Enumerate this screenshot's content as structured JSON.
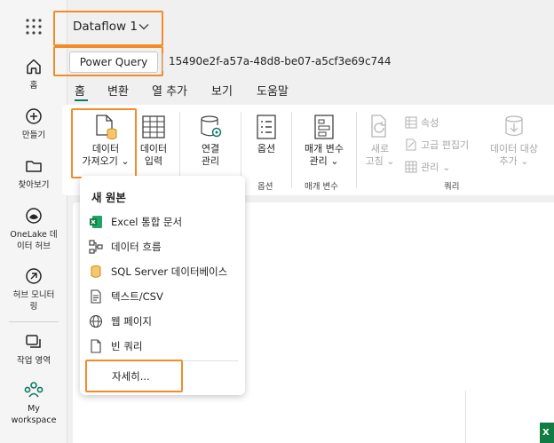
{
  "header": {
    "title": "Dataflow 1"
  },
  "query_bar": {
    "power_query_label": "Power Query",
    "query_id": "15490e2f-a57a-48d8-be07-a5cf3e69c744"
  },
  "rail": {
    "items": [
      {
        "label": "홈",
        "icon": "home-icon"
      },
      {
        "label": "만들기",
        "icon": "plus-circle-icon"
      },
      {
        "label": "찾아보기",
        "icon": "folder-icon"
      },
      {
        "label": "OneLake 데이터 허브",
        "line1": "OneLake 데",
        "line2": "이터 허브",
        "icon": "onelake-icon"
      },
      {
        "label": "허브 모니터링",
        "line1": "허브 모니터",
        "line2": "링",
        "icon": "monitor-icon"
      },
      {
        "label": "작업 영역",
        "icon": "workspaces-icon"
      },
      {
        "label": "My workspace",
        "line1": "My",
        "line2": "workspace",
        "icon": "my-workspace-icon"
      }
    ]
  },
  "tabs": [
    "홈",
    "변환",
    "열 추가",
    "보기",
    "도움말"
  ],
  "ribbon": {
    "get_data": {
      "line1": "데이터",
      "line2": "가져오기"
    },
    "enter_data": {
      "line1": "데이터",
      "line2": "입력"
    },
    "manage_connections": {
      "line1": "연결",
      "line2": "관리"
    },
    "options": {
      "line1": "옵션"
    },
    "manage_parameters": {
      "line1": "매개 변수",
      "line2": "관리"
    },
    "refresh": {
      "line1": "새로",
      "line2": "고침"
    },
    "properties": "속성",
    "advanced_editor": "고급 편집기",
    "manage": "관리",
    "data_destination": {
      "line1": "데이터 대상",
      "line2": "추가"
    },
    "groups": {
      "options": "옵션",
      "parameters": "매개 변수",
      "query": "쿼리"
    }
  },
  "dropdown": {
    "title": "새 원본",
    "items": [
      {
        "label": "Excel 통합 문서",
        "icon": "excel-icon"
      },
      {
        "label": "데이터 흐름",
        "icon": "dataflow-icon"
      },
      {
        "label": "SQL Server 데이터베이스",
        "icon": "database-icon"
      },
      {
        "label": "텍스트/CSV",
        "icon": "text-file-icon"
      },
      {
        "label": "웹 페이지",
        "icon": "globe-icon"
      },
      {
        "label": "빈 쿼리",
        "icon": "blank-query-icon"
      }
    ],
    "more": "자세히..."
  },
  "colors": {
    "highlight": "#f28c28",
    "accent": "#117865",
    "excel": "#107c41"
  }
}
